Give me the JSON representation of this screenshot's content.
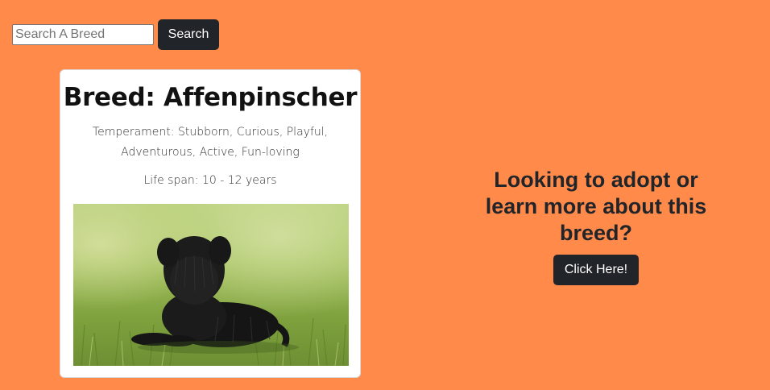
{
  "search": {
    "placeholder": "Search A Breed",
    "value": "",
    "button_label": "Search"
  },
  "breed_card": {
    "title": "Breed: Affenpinscher",
    "temperament": "Temperament: Stubborn, Curious, Playful, Adventurous, Active, Fun-loving",
    "life_span": "Life span: 10 - 12 years",
    "image_subject": "black-affenpinscher-dog-on-grass"
  },
  "cta": {
    "heading": "Looking to adopt or learn more about this breed?",
    "button_label": "Click Here!"
  },
  "colors": {
    "background": "#ff8a4a",
    "button_dark": "#212529",
    "card": "#ffffff"
  }
}
